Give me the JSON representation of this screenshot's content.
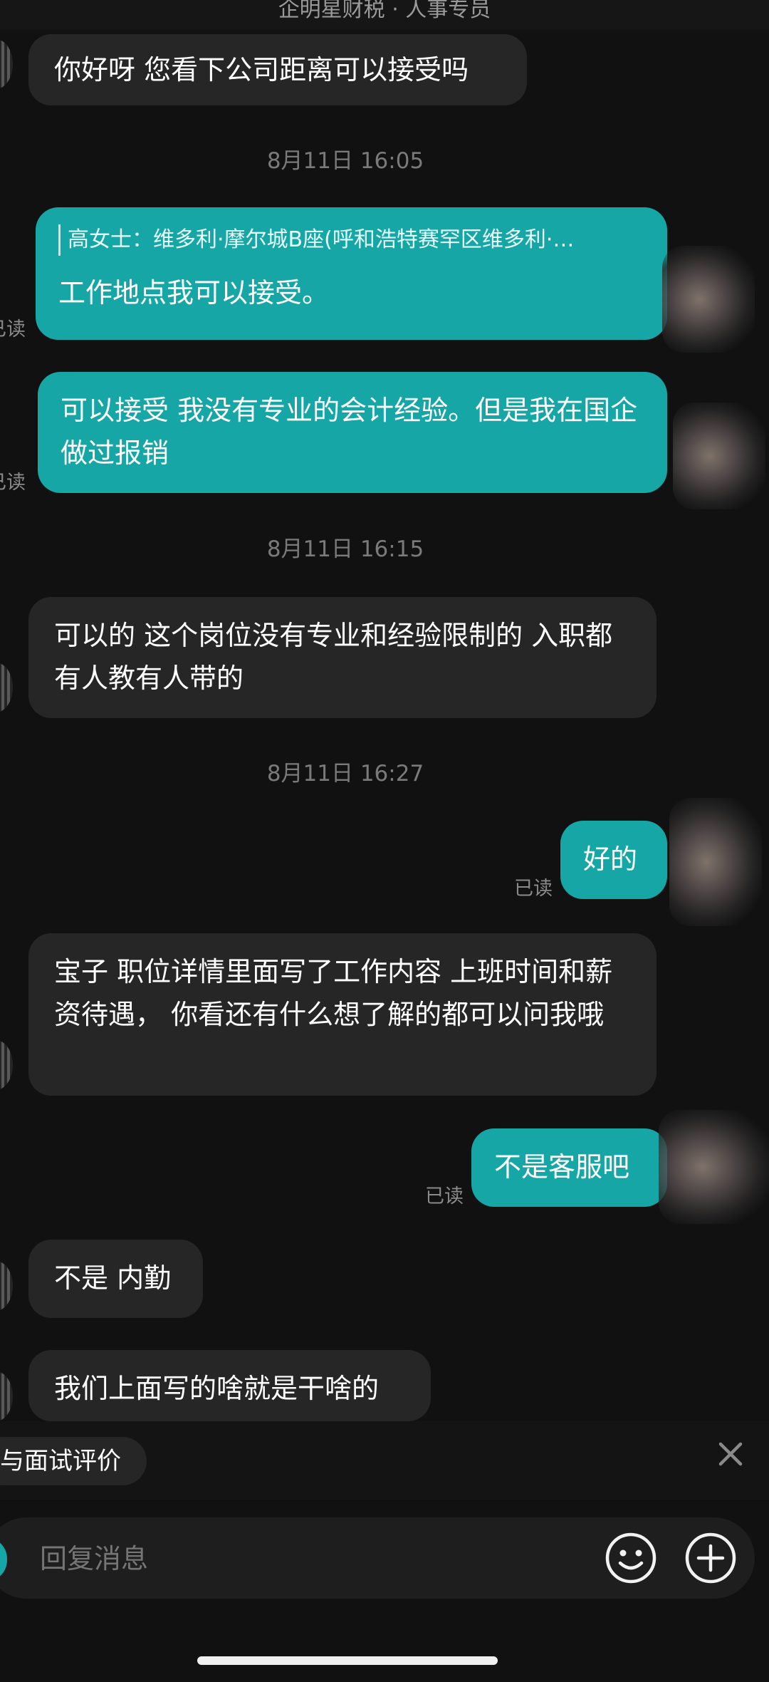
{
  "header": {
    "title": "企明星财税 · 人事专员"
  },
  "messages": [
    {
      "text": "你好呀 您看下公司距离可以接受吗"
    },
    {
      "time": "8月11日 16:05"
    },
    {
      "quote": "高女士：维多利·摩尔城B座(呼和浩特赛罕区维多利·…",
      "text": "工作地点我可以接受。",
      "read": "已读"
    },
    {
      "text": "可以接受  我没有专业的会计经验。但是我在国企做过报销",
      "read": "已读"
    },
    {
      "time": "8月11日 16:15"
    },
    {
      "text": "可以的 这个岗位没有专业和经验限制的 入职都有人教有人带的"
    },
    {
      "time": "8月11日 16:27"
    },
    {
      "text": "好的",
      "read": "已读"
    },
    {
      "text": "宝子 职位详情里面写了工作内容 上班时间和薪资待遇， 你看还有什么想了解的都可以问我哦"
    },
    {
      "text": "不是客服吧",
      "read": "已读"
    },
    {
      "text": "不是 内勤"
    },
    {
      "text": "我们上面写的啥就是干啥的"
    }
  ],
  "quick_action": {
    "label": "与面试评价"
  },
  "composer": {
    "placeholder": "回复消息"
  },
  "colors": {
    "accent": "#17a6a6",
    "incoming_bubble": "#262626",
    "background": "#111111"
  },
  "icons": {
    "close": "close-icon",
    "emoji": "emoji-icon",
    "plus": "plus-icon"
  }
}
